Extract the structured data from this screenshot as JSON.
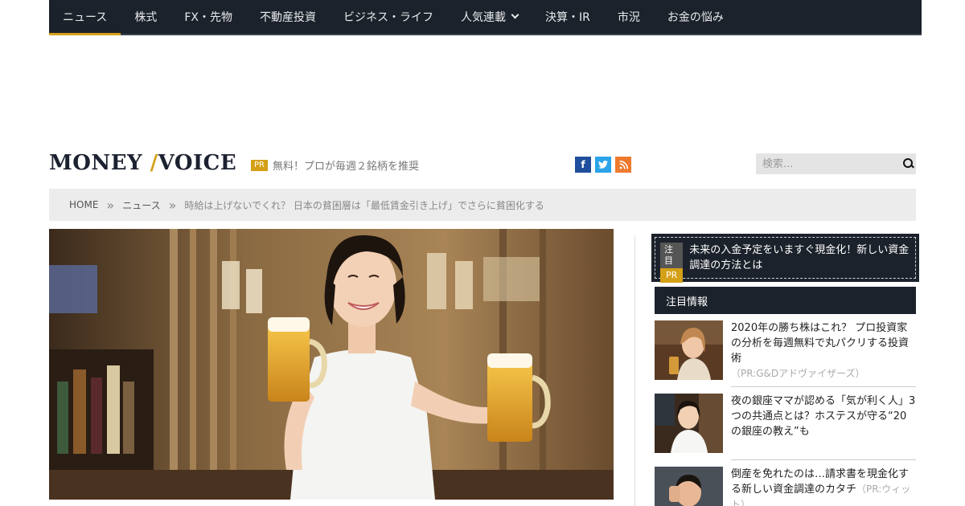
{
  "nav": {
    "items": [
      {
        "label": "ニュース",
        "active": true,
        "dropdown": false
      },
      {
        "label": "株式",
        "active": false,
        "dropdown": false
      },
      {
        "label": "FX・先物",
        "active": false,
        "dropdown": false
      },
      {
        "label": "不動産投資",
        "active": false,
        "dropdown": false
      },
      {
        "label": "ビジネス・ライフ",
        "active": false,
        "dropdown": false
      },
      {
        "label": "人気連載",
        "active": false,
        "dropdown": true
      },
      {
        "label": "決算・IR",
        "active": false,
        "dropdown": false
      },
      {
        "label": "市況",
        "active": false,
        "dropdown": false
      },
      {
        "label": "お金の悩み",
        "active": false,
        "dropdown": false
      }
    ]
  },
  "header": {
    "logo_left": "MONEY",
    "logo_right": "VOICE",
    "pr_badge": "PR",
    "pr_text": "無料！プロが毎週２銘柄を推奨",
    "social": [
      {
        "icon": "facebook-icon",
        "glyph": "f"
      },
      {
        "icon": "twitter-icon",
        "glyph": "t"
      },
      {
        "icon": "rss-icon",
        "glyph": "◉"
      }
    ],
    "search_placeholder": "検索..."
  },
  "breadcrumb": {
    "home": "HOME",
    "sep": "»",
    "section": "ニュース",
    "current": "時給は上げないでくれ？ 日本の貧困層は「最低賃金引き上げ」でさらに貧困化する"
  },
  "sidebar": {
    "promo": {
      "badge_note": "注目",
      "badge_pr": "PR",
      "text": "未来の入金予定をいますぐ現金化！新しい資金調達の方法とは"
    },
    "section_title": "注目情報",
    "items": [
      {
        "title": "2020年の勝ち株はこれ？ プロ投資家の分析を毎週無料で丸パクリする投資術",
        "source": "（PR:G&Dアドヴァイザーズ）"
      },
      {
        "title": "夜の銀座ママが認める「気が利く人」3つの共通点とは？ホステスが守る“20の銀座の教え”も",
        "source": ""
      },
      {
        "title": "倒産を免れたのは…請求書を現金化する新しい資金調達のカタチ",
        "source": "（PR:ウィット）"
      }
    ]
  },
  "colors": {
    "nav_bg": "#1c222b",
    "accent": "#d4a017",
    "breadcrumb_bg": "#ececec"
  }
}
